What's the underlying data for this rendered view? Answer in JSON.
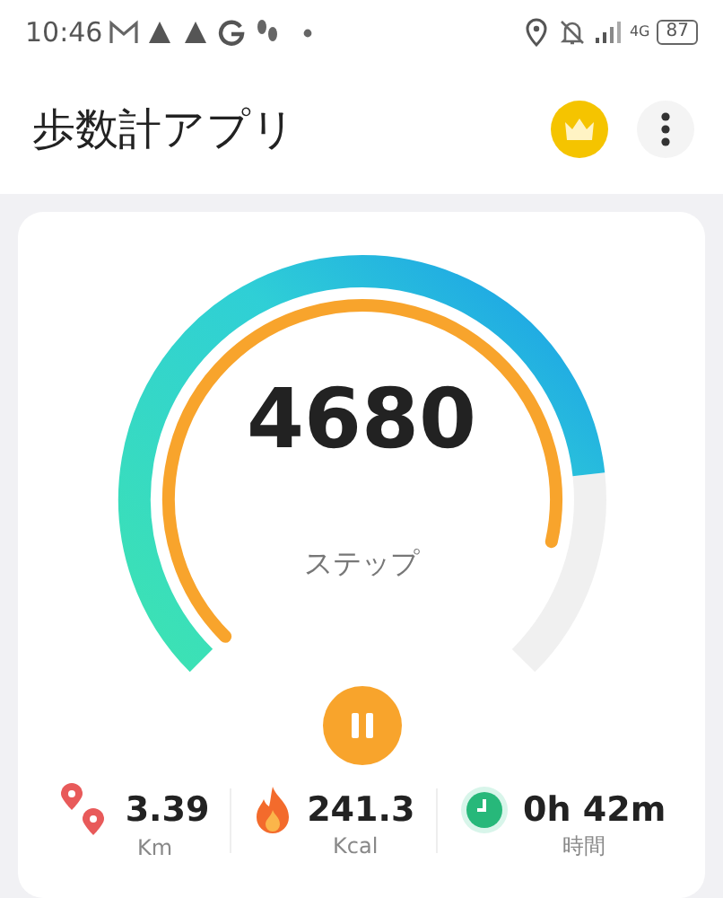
{
  "status_bar": {
    "time": "10:46",
    "network": "4G",
    "battery": "87"
  },
  "app_bar": {
    "title": "歩数計アプリ"
  },
  "gauge": {
    "steps": "4680",
    "unit": "ステップ"
  },
  "stats": [
    {
      "kind": "distance",
      "value": "3.39",
      "unit": "Km"
    },
    {
      "kind": "calories",
      "value": "241.3",
      "unit": "Kcal"
    },
    {
      "kind": "time",
      "value": "0h 42m",
      "unit": "時間"
    }
  ]
}
